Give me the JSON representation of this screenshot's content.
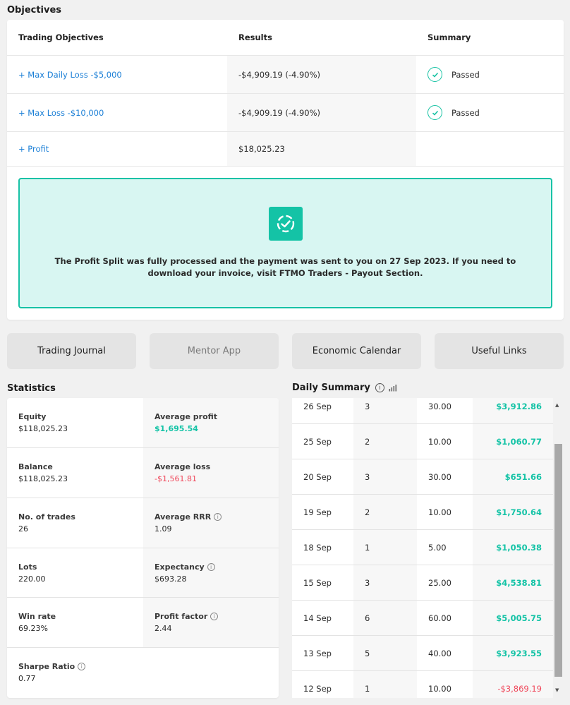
{
  "objectives": {
    "title": "Objectives",
    "headers": {
      "objective": "Trading Objectives",
      "results": "Results",
      "summary": "Summary"
    },
    "rows": [
      {
        "objective": "+ Max Daily Loss -$5,000",
        "result": "-$4,909.19 (-4.90%)",
        "summary": "Passed"
      },
      {
        "objective": "+ Max Loss -$10,000",
        "result": "-$4,909.19 (-4.90%)",
        "summary": "Passed"
      },
      {
        "objective": "+ Profit",
        "result": "$18,025.23",
        "summary": ""
      }
    ],
    "notice": "The Profit Split was fully processed and the payment was sent to you on 27 Sep 2023. If you need to download your invoice, visit FTMO Traders - Payout Section."
  },
  "buttons": {
    "trading_journal": "Trading Journal",
    "mentor_app": "Mentor App",
    "economic_calendar": "Economic Calendar",
    "useful_links": "Useful Links"
  },
  "statistics": {
    "title": "Statistics",
    "left": [
      {
        "label": "Equity",
        "value": "$118,025.23"
      },
      {
        "label": "Balance",
        "value": "$118,025.23"
      },
      {
        "label": "No. of trades",
        "value": "26"
      },
      {
        "label": "Lots",
        "value": "220.00"
      },
      {
        "label": "Win rate",
        "value": "69.23%"
      },
      {
        "label": "Sharpe Ratio",
        "value": "0.77"
      }
    ],
    "right": [
      {
        "label": "Average profit",
        "value": "$1,695.54"
      },
      {
        "label": "Average loss",
        "value": "-$1,561.81"
      },
      {
        "label": "Average RRR",
        "value": "1.09"
      },
      {
        "label": "Expectancy",
        "value": "$693.28"
      },
      {
        "label": "Profit factor",
        "value": "2.44"
      }
    ]
  },
  "daily_summary": {
    "title": "Daily Summary",
    "rows": [
      {
        "date": "26 Sep",
        "trades": "3",
        "lots": "30.00",
        "result": "$3,912.86"
      },
      {
        "date": "25 Sep",
        "trades": "2",
        "lots": "10.00",
        "result": "$1,060.77"
      },
      {
        "date": "20 Sep",
        "trades": "3",
        "lots": "30.00",
        "result": "$651.66"
      },
      {
        "date": "19 Sep",
        "trades": "2",
        "lots": "10.00",
        "result": "$1,750.64"
      },
      {
        "date": "18 Sep",
        "trades": "1",
        "lots": "5.00",
        "result": "$1,050.38"
      },
      {
        "date": "15 Sep",
        "trades": "3",
        "lots": "25.00",
        "result": "$4,538.81"
      },
      {
        "date": "14 Sep",
        "trades": "6",
        "lots": "60.00",
        "result": "$5,005.75"
      },
      {
        "date": "13 Sep",
        "trades": "5",
        "lots": "40.00",
        "result": "$3,923.55"
      },
      {
        "date": "12 Sep",
        "trades": "1",
        "lots": "10.00",
        "result": "-$3,869.19"
      }
    ]
  },
  "colors": {
    "accent": "#14c3a6",
    "link": "#1b7fd6",
    "negative": "#f0475a",
    "notice_bg": "#d8f6f2"
  },
  "icons": {
    "passed": "check-circle-icon",
    "notice": "dashed-check-icon",
    "info": "info-icon",
    "chart": "bar-chart-icon"
  }
}
